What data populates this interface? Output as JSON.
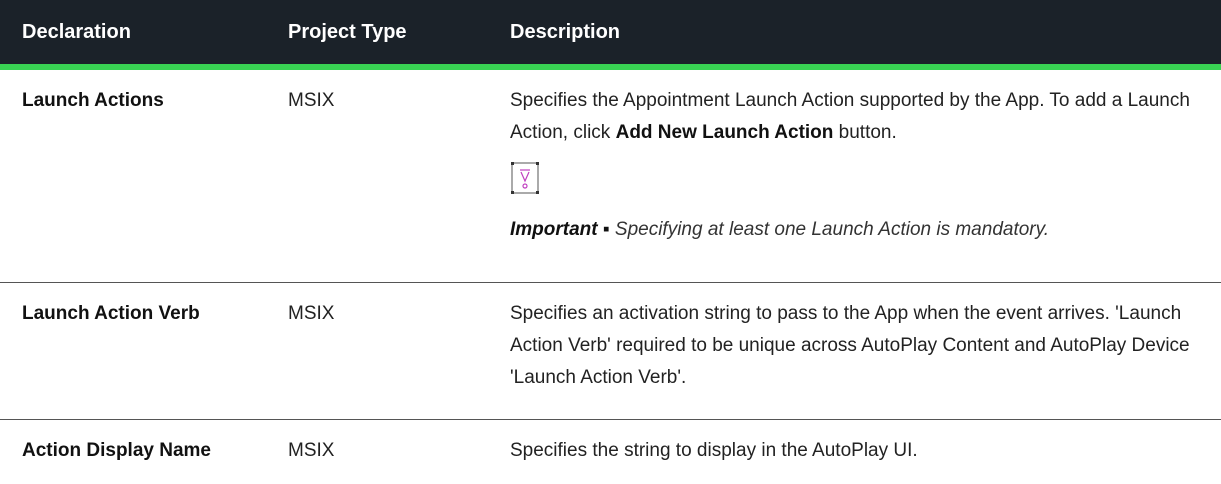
{
  "header": {
    "col1": "Declaration",
    "col2": "Project Type",
    "col3": "Description"
  },
  "rows": [
    {
      "declaration": "Launch Actions",
      "project_type": "MSIX",
      "desc_part1": "Specifies the Appointment Launch Action supported by the App. To add a Launch Action, click ",
      "desc_bold": "Add New Launch Action",
      "desc_part2": " button.",
      "note_label": "Important",
      "note_sep": " ▪ ",
      "note_text": "Specifying at least one Launch Action is mandatory."
    },
    {
      "declaration": "Launch Action Verb",
      "project_type": "MSIX",
      "description": "Specifies an activation string to pass to the App when the event arrives. 'Launch Action Verb' required to be unique across AutoPlay Content and AutoPlay Device 'Launch Action Verb'."
    },
    {
      "declaration": "Action Display Name",
      "project_type": "MSIX",
      "description": "Specifies the string to display in the AutoPlay UI."
    }
  ],
  "icons": {
    "note": "important-note-icon"
  },
  "colors": {
    "header_bg": "#1b2229",
    "header_accent": "#39d353",
    "icon_accent": "#c040c0"
  }
}
